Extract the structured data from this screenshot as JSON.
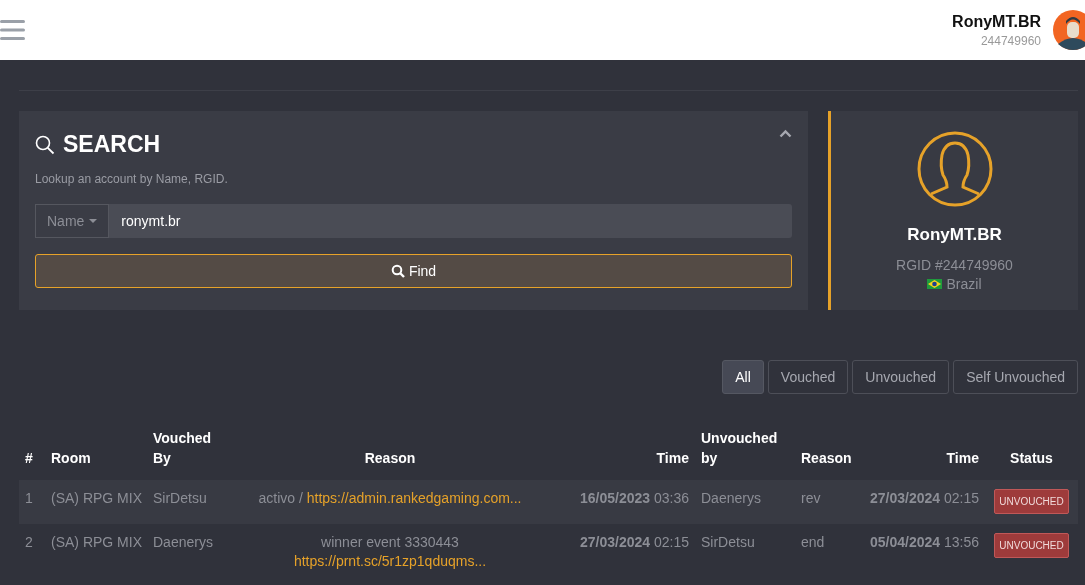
{
  "header": {
    "user_name": "RonyMT.BR",
    "user_id": "244749960"
  },
  "search": {
    "title": "SEARCH",
    "subtitle": "Lookup an account by Name, RGID.",
    "field_type": "Name",
    "value": "ronymt.br",
    "button": "Find",
    "expanded": true
  },
  "profile": {
    "name": "RonyMT.BR",
    "rgid": "RGID #244749960",
    "country": "Brazil"
  },
  "filters": [
    {
      "label": "All",
      "selected": true
    },
    {
      "label": "Vouched",
      "selected": false
    },
    {
      "label": "Unvouched",
      "selected": false
    },
    {
      "label": "Self Unvouched",
      "selected": false
    }
  ],
  "table": {
    "columns": [
      "#",
      "Room",
      "Vouched By",
      "Reason",
      "Time",
      "Unvouched by",
      "Reason",
      "Time",
      "Status"
    ],
    "rows": [
      {
        "index": "1",
        "room": "(SA) RPG MIX",
        "vouched_by": "SirDetsu",
        "reason_text": "activo / ",
        "reason_link": "https://admin.rankedgaming.com...",
        "vouch_date": "16/05/2023",
        "vouch_time": "03:36",
        "unvouched_by": "Daenerys",
        "unvouch_reason": "rev",
        "unvouch_date": "27/03/2024",
        "unvouch_time": "02:15",
        "status": "UNVOUCHED"
      },
      {
        "index": "2",
        "room": "(SA) RPG MIX",
        "vouched_by": "Daenerys",
        "reason_text": "winner event 3330443 ",
        "reason_link": "https://prnt.sc/5r1zp1qduqms...",
        "vouch_date": "27/03/2024",
        "vouch_time": "02:15",
        "unvouched_by": "SirDetsu",
        "unvouch_reason": "end",
        "unvouch_date": "05/04/2024",
        "unvouch_time": "13:56",
        "status": "UNVOUCHED"
      }
    ]
  }
}
